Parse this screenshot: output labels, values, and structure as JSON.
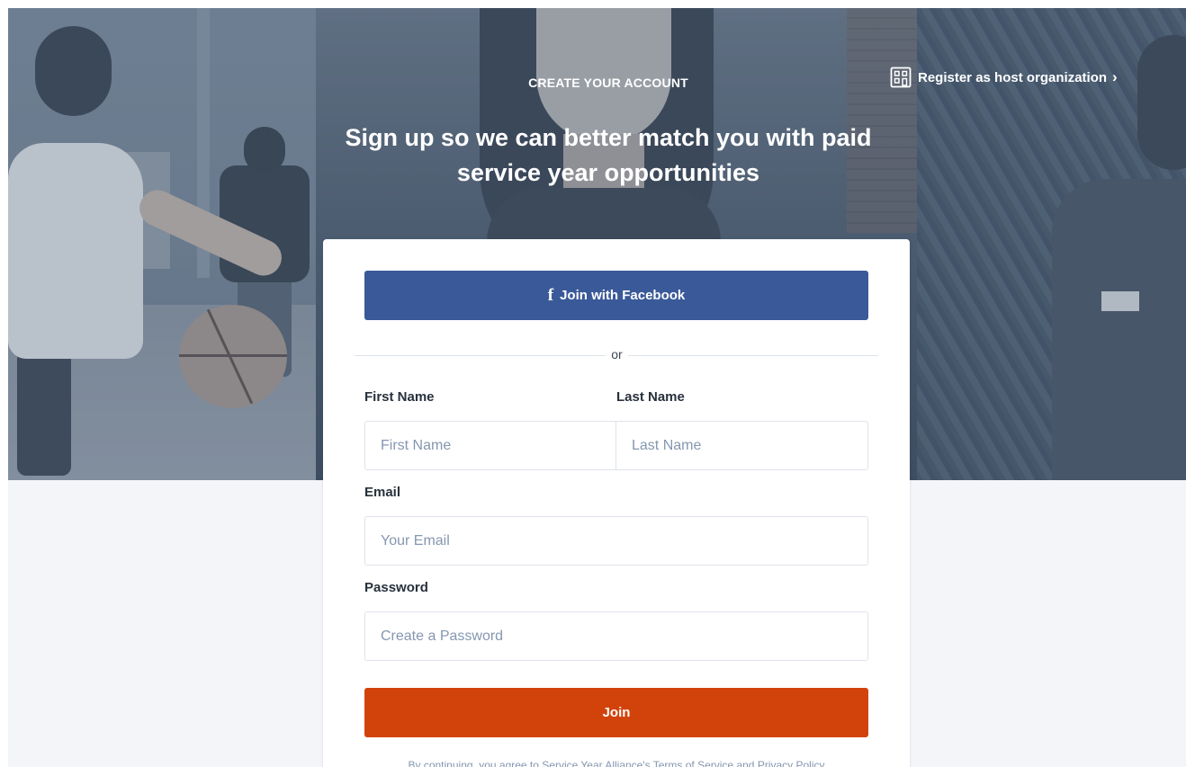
{
  "hero": {
    "eyebrow": "CREATE YOUR ACCOUNT",
    "title": "Sign up so we can better match you with paid service year opportunities",
    "host_link_label": "Register as host organization",
    "host_link_icon": "building-icon"
  },
  "form": {
    "facebook_label": "Join with Facebook",
    "facebook_icon": "facebook-icon",
    "divider_text": "or",
    "first_name": {
      "label": "First Name",
      "placeholder": "First Name",
      "value": ""
    },
    "last_name": {
      "label": "Last Name",
      "placeholder": "Last Name",
      "value": ""
    },
    "email": {
      "label": "Email",
      "placeholder": "Your Email",
      "value": ""
    },
    "password": {
      "label": "Password",
      "placeholder": "Create a Password",
      "value": ""
    },
    "join_label": "Join",
    "terms_prefix": "By continuing, you agree to Service Year Alliance's ",
    "terms_link": "Terms of Service",
    "terms_and": " and ",
    "privacy_link": "Privacy Policy"
  },
  "colors": {
    "facebook": "#3a5998",
    "join": "#d2430c",
    "placeholder": "#8597b0",
    "label": "#28313c"
  }
}
